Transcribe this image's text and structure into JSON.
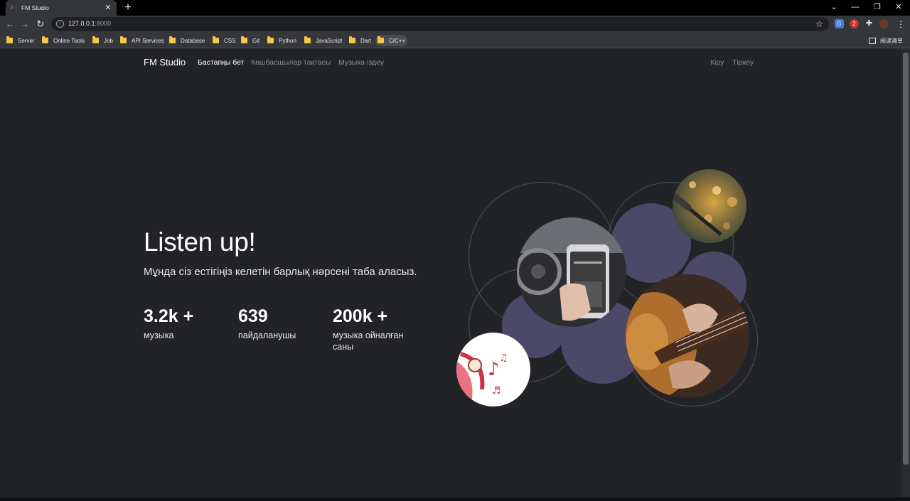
{
  "browser": {
    "tab_title": "FM Studio",
    "tab_close": "✕",
    "new_tab": "+",
    "url_host": "127.0.0.1",
    "url_port": ":8000",
    "bookmarks": [
      "Server",
      "Online Tools",
      "Job",
      "API Services",
      "Database",
      "CSS",
      "Git",
      "Python",
      "JavaScript",
      "Dart",
      "C/C++"
    ],
    "reading_list": "阅读清单",
    "controls": {
      "minimize": "—",
      "restore": "❐",
      "close": "✕",
      "tab_search": "⌄"
    }
  },
  "site": {
    "brand": "FM Studio",
    "nav": {
      "home": "Бастапқы бет",
      "leaderboard": "Көшбасшылар тақтасы",
      "search": "Музыка іздеу"
    },
    "auth": {
      "login": "Кіру",
      "register": "Тіркеу"
    }
  },
  "hero": {
    "title": "Listen up!",
    "subtitle": "Мұнда сіз естігіңіз келетін барлық нәрсені таба аласыз.",
    "stats": [
      {
        "value": "3.2k +",
        "label": "музыка"
      },
      {
        "value": "639",
        "label": "пайдаланушы"
      },
      {
        "value": "200k +",
        "label": "музыка ойналған саны"
      }
    ]
  },
  "colors": {
    "page_bg": "#212327",
    "accent_blob": "#4b4868",
    "text": "#ffffff",
    "muted_link": "#8b8d91"
  }
}
